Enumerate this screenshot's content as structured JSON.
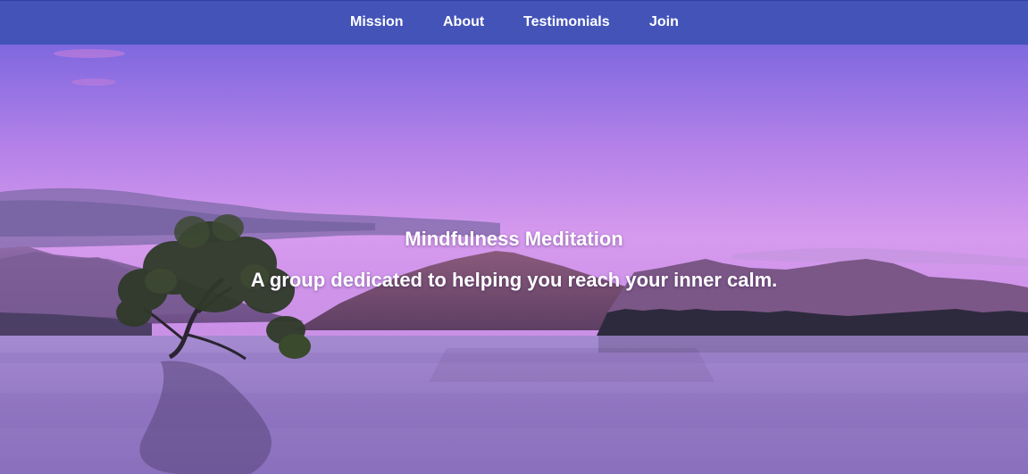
{
  "nav": {
    "items": [
      {
        "label": "Mission"
      },
      {
        "label": "About"
      },
      {
        "label": "Testimonials"
      },
      {
        "label": "Join"
      }
    ],
    "background": "#4353b8"
  },
  "hero": {
    "title": "Mindfulness Meditation",
    "subtitle": "A group dedicated to helping you reach your inner calm.",
    "text_color": "#ffffff"
  }
}
